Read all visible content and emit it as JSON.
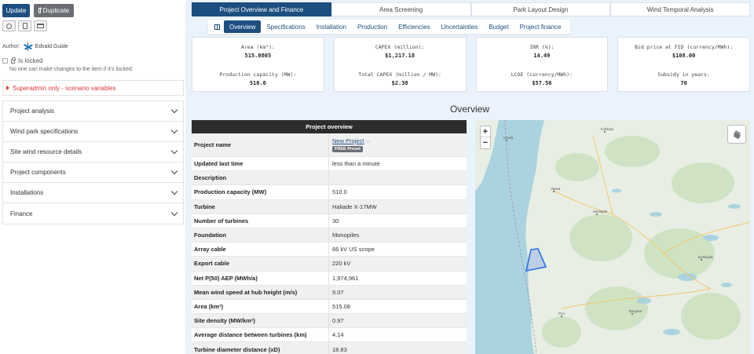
{
  "sidebar": {
    "update_label": "Update",
    "duplicate_label": "Duplicate",
    "author_label": "Author:",
    "author_name": "Edvald Guide",
    "locked_label": "Is locked",
    "locked_note": "No one can make changes to the item if it's locked.",
    "superadmin_label": "Superadmin only - scenario variables",
    "sections": [
      "Project analysis",
      "Wind park specifications",
      "Site wind resource details",
      "Project components",
      "Installations",
      "Finance"
    ]
  },
  "tabs": [
    "Project Overview and Finance",
    "Area Screening",
    "Park Layout Design",
    "Wind Temporal Analysis"
  ],
  "subtabs": [
    "Overview",
    "Specifications",
    "Installation",
    "Production",
    "Efficiencies",
    "Uncertainties",
    "Budget",
    "Project finance"
  ],
  "cards": [
    {
      "l1": "Area (km²):",
      "v1": "515.0805",
      "l2": "Production capacity (MW):",
      "v2": "510.0"
    },
    {
      "l1": "CAPEX (million):",
      "v1": "$1,217.18",
      "l2": "Total CAPEX (million / MW):",
      "v2": "$2.38"
    },
    {
      "l1": "IRR (%):",
      "v1": "14.49",
      "l2": "LCOE (currency/MWh):",
      "v2": "$57.56"
    },
    {
      "l1": "Bid price at FID (currency/MWh):",
      "v1": "$108.00",
      "l2": "Subsidy in years:",
      "v2": "70"
    }
  ],
  "overview_title": "Overview",
  "table": {
    "header": "Project overview",
    "name_key": "Project name",
    "name_value": "New Project",
    "link_glyph": "⇔",
    "badge": "FREE Preset",
    "rows": [
      {
        "k": "Updated last time",
        "v": "less than a minute"
      },
      {
        "k": "Description",
        "v": ""
      },
      {
        "k": "Production capacity (MW)",
        "v": "510.0"
      },
      {
        "k": "Turbine",
        "v": "Haliade X-17MW"
      },
      {
        "k": "Number of turbines",
        "v": "30"
      },
      {
        "k": "Foundation",
        "v": "Monopiles"
      },
      {
        "k": "Array cable",
        "v": "66 kV US scope"
      },
      {
        "k": "Export cable",
        "v": "220 kV"
      },
      {
        "k": "Net P(50) AEP (MWh/a)",
        "v": "1,974,961"
      },
      {
        "k": "Mean wind speed at hub height (m/s)",
        "v": "9.07"
      },
      {
        "k": "Area (km²)",
        "v": "515.08"
      },
      {
        "k": "Site density (MW/km²)",
        "v": "0.97"
      },
      {
        "k": "Average distance between turbines (km)",
        "v": "4.14"
      },
      {
        "k": "Turbine diameter distance (xD)",
        "v": "18.83"
      }
    ]
  },
  "map": {
    "zoom_in": "+",
    "zoom_out": "−",
    "towns": [
      {
        "name": "Umeå"
      },
      {
        "name": "Kokkola"
      },
      {
        "name": "Vaasa"
      },
      {
        "name": "Seinäjoki"
      },
      {
        "name": "Jyväskylä"
      },
      {
        "name": "Pori"
      },
      {
        "name": "Tampere"
      }
    ]
  }
}
